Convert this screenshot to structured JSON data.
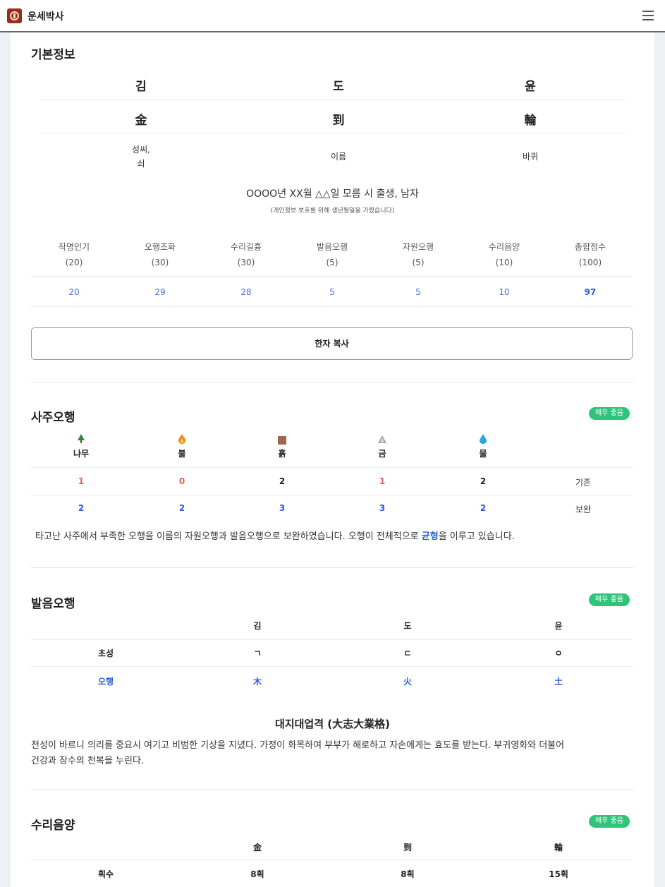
{
  "app": {
    "title": "운세박사"
  },
  "basic": {
    "title": "기본정보",
    "name_hangul": [
      "김",
      "도",
      "윤"
    ],
    "name_hanja": [
      "金",
      "到",
      "輪"
    ],
    "meanings": [
      [
        "성씨,",
        "쇠"
      ],
      [
        "이름"
      ],
      [
        "바퀴"
      ]
    ],
    "birth": "OOOO년 XX월 △△일 모름 시 출생, 남자",
    "privacy_note": "(개인정보 보호를 위해 생년월일을 가렸습니다)",
    "score_headers": [
      [
        "작명인기",
        "(20)"
      ],
      [
        "오행조화",
        "(30)"
      ],
      [
        "수리길흉",
        "(30)"
      ],
      [
        "발음오행",
        "(5)"
      ],
      [
        "자원오행",
        "(5)"
      ],
      [
        "수리음양",
        "(10)"
      ],
      [
        "종합점수",
        "(100)"
      ]
    ],
    "score_values": [
      "20",
      "29",
      "28",
      "5",
      "5",
      "10",
      "97"
    ],
    "copy_button": "한자 복사"
  },
  "saju": {
    "title": "사주오행",
    "badge": "매우 좋음",
    "elements": [
      {
        "label": "나무",
        "icon": "tree-icon"
      },
      {
        "label": "불",
        "icon": "fire-icon"
      },
      {
        "label": "흙",
        "icon": "earth-icon"
      },
      {
        "label": "금",
        "icon": "metal-icon"
      },
      {
        "label": "물",
        "icon": "water-icon"
      }
    ],
    "existing_values": [
      "1",
      "0",
      "2",
      "1",
      "2"
    ],
    "existing_label": "기존",
    "supplement_values": [
      "2",
      "2",
      "3",
      "3",
      "2"
    ],
    "supplement_label": "보완",
    "desc_prefix": "타고난 사주에서 부족한 오행을 이름의 자원오행과 발음오행으로 보완하였습니다. 오행이 전체적으로 ",
    "desc_highlight": "균형",
    "desc_suffix": "을 이루고 있습니다."
  },
  "pron": {
    "title": "발음오행",
    "badge": "매우 좋음",
    "columns": [
      "김",
      "도",
      "윤"
    ],
    "row1_label": "초성",
    "row1": [
      "ㄱ",
      "ㄷ",
      "ㅇ"
    ],
    "row2_label": "오행",
    "row2": [
      "木",
      "火",
      "土"
    ],
    "subtitle": "대지대업격 (大志大業格)",
    "desc_line1": "천성이 바르니 의리를 중요시 여기고 비범한 기상을 지녔다. 가정이 화목하여 부부가 해로하고 자손에게는 효도를 받는다. 부귀영화와 더불어",
    "desc_line2": "건강과 장수의 천복을 누린다."
  },
  "yinyang": {
    "title": "수리음양",
    "badge": "매우 좋음",
    "columns": [
      "金",
      "到",
      "輪"
    ],
    "row1_label": "획수",
    "row1": [
      "8획",
      "8획",
      "15획"
    ]
  },
  "colors": {
    "accent_blue": "#2c5fd6",
    "red": "#e06060",
    "badge_green": "#2ec47a"
  }
}
